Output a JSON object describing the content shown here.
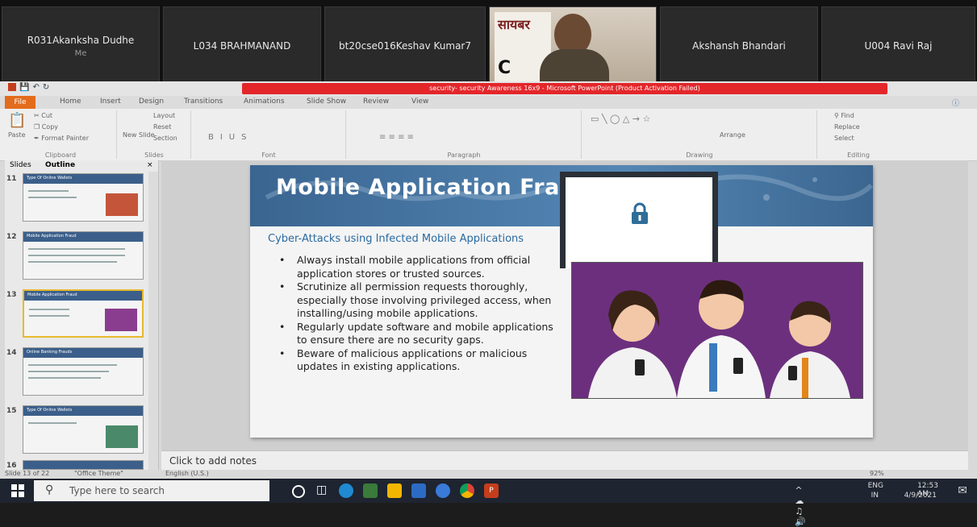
{
  "participants": [
    {
      "name": "R031Akanksha Dudhe",
      "sub": "Me"
    },
    {
      "name": "L034 BRAHMANAND"
    },
    {
      "name": "bt20cse016Keshav Kumar7"
    },
    {
      "video_sign_text": "सायबर",
      "video_sign_letter": "C"
    },
    {
      "name": "Akshansh Bhandari"
    },
    {
      "name": "U004 Ravi Raj"
    }
  ],
  "ppt": {
    "title": "security- security Awareness 16x9 - Microsoft PowerPoint (Product Activation Failed)",
    "tabs": [
      "File",
      "Home",
      "Insert",
      "Design",
      "Transitions",
      "Animations",
      "Slide Show",
      "Review",
      "View"
    ],
    "ribbon": {
      "clipboard": {
        "cut": "Cut",
        "copy": "Copy",
        "paste": "Paste",
        "format_painter": "Format Painter",
        "label": "Clipboard"
      },
      "slides": {
        "new_slide": "New Slide",
        "layout": "Layout",
        "reset": "Reset",
        "section": "Section",
        "label": "Slides"
      },
      "font_label": "Font",
      "paragraph_label": "Paragraph",
      "drawing": {
        "arrange": "Arrange",
        "label": "Drawing"
      },
      "editing": {
        "find": "Find",
        "replace": "Replace",
        "select": "Select",
        "label": "Editing"
      }
    },
    "pane_tabs": [
      "Slides",
      "Outline"
    ],
    "thumbnails": [
      {
        "num": "11",
        "title": "Type Of Online Wallets"
      },
      {
        "num": "12",
        "title": "Mobile Application Fraud"
      },
      {
        "num": "13",
        "title": "Mobile Application Fraud"
      },
      {
        "num": "14",
        "title": "Online Banking Frauds"
      },
      {
        "num": "15",
        "title": "Type Of Online Wallets"
      },
      {
        "num": "16",
        "title": ""
      }
    ],
    "slide": {
      "title": "Mobile Application Fra",
      "subtitle": "Cyber-Attacks using Infected Mobile Applications",
      "bullets": [
        "Always install mobile applications from official application stores or trusted sources.",
        "Scrutinize all permission requests thoroughly, especially those involving privileged access, when installing/using mobile applications.",
        "Regularly update software and mobile applications to ensure there are no security gaps.",
        "Beware of malicious applications or malicious updates in existing applications."
      ]
    },
    "notes_placeholder": "Click to add notes",
    "status": {
      "slide": "Slide 13 of 22",
      "theme": "\"Office Theme\"",
      "language": "English (U.S.)",
      "zoom": "92%"
    }
  },
  "taskbar": {
    "search_placeholder": "Type here to search",
    "lang": "ENG",
    "region": "IN",
    "time": "12:53 AM",
    "date": "4/9/2021"
  },
  "colors": {
    "accent_file_tab": "#e36c1c",
    "title_bar_red": "#e3262a",
    "slide_banner": "#3a6591"
  }
}
